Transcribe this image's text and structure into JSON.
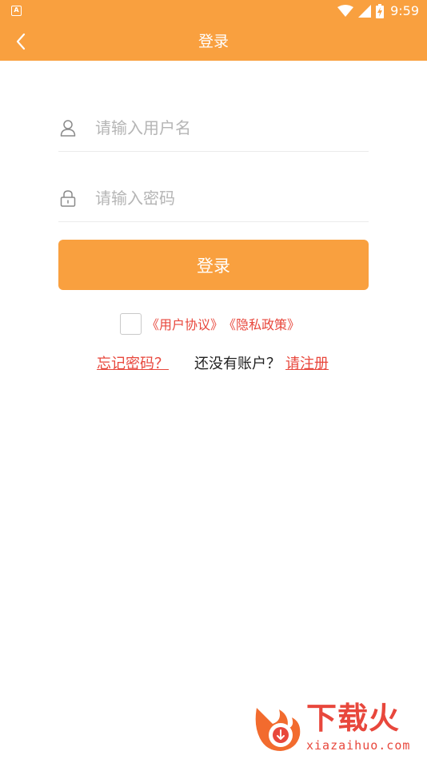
{
  "status_bar": {
    "time": "9:59",
    "app_badge": "A",
    "icons": [
      "wifi-icon",
      "signal-icon",
      "battery-icon"
    ]
  },
  "header": {
    "title": "登录",
    "back_icon": "chevron-left-icon"
  },
  "form": {
    "username_placeholder": "请输入用户名",
    "username_value": "",
    "password_placeholder": "请输入密码",
    "password_value": "",
    "login_label": "登录"
  },
  "agreement": {
    "checked": false,
    "user_agreement": "《用户协议》",
    "privacy_policy": "《隐私政策》"
  },
  "links": {
    "forgot": "忘记密码？",
    "no_account": "还没有账户？",
    "register": "请注册"
  },
  "watermark": {
    "brand": "下载火",
    "url": "xiazaihuo.com"
  },
  "colors": {
    "primary": "#F9A03F",
    "link": "#E8473C",
    "placeholder": "#B5B5B5"
  }
}
